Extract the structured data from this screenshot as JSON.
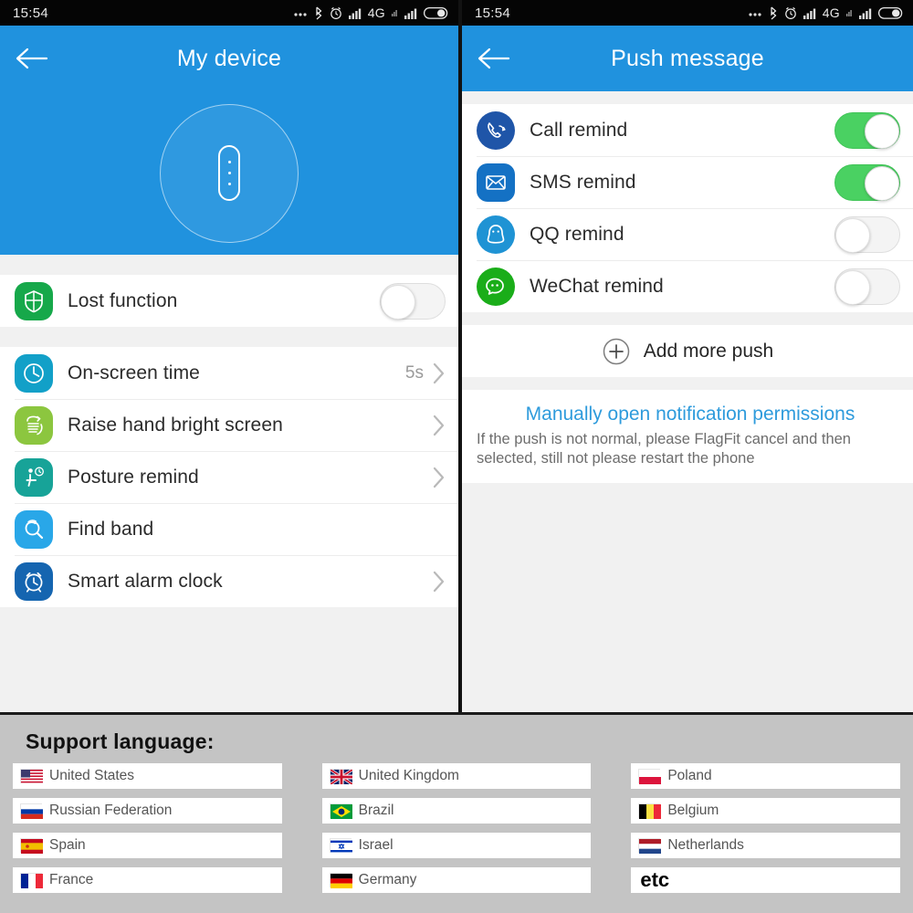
{
  "status_bar": {
    "time": "15:54",
    "icons": [
      "more-dots-icon",
      "bluetooth-icon",
      "alarm-icon",
      "signal-bars-icon",
      "network-4g-label",
      "signal-bars-2-icon",
      "battery-icon"
    ],
    "network_label": "4G"
  },
  "left_panel": {
    "title": "My device",
    "back_label": "back-arrow",
    "device_illustration": "smart-band-in-circle",
    "group_one": [
      {
        "label": "Lost function",
        "icon": "shield-lost-icon",
        "icon_color": "#16a84a",
        "toggle": "off"
      }
    ],
    "group_two": [
      {
        "label": "On-screen time",
        "icon": "clock-icon",
        "icon_color": "#12a0c8",
        "value": "5s",
        "chevron": true
      },
      {
        "label": "Raise hand bright screen",
        "icon": "raise-hand-icon",
        "icon_color": "#8cc63f",
        "value": "",
        "chevron": true
      },
      {
        "label": "Posture remind",
        "icon": "posture-icon",
        "icon_color": "#17a398",
        "value": "",
        "chevron": true
      },
      {
        "label": "Find band",
        "icon": "find-band-icon",
        "icon_color": "#29a7e8",
        "value": "",
        "chevron": false
      },
      {
        "label": "Smart alarm clock",
        "icon": "alarm-clock-icon",
        "icon_color": "#1565b0",
        "value": "",
        "chevron": true
      }
    ]
  },
  "right_panel": {
    "title": "Push message",
    "back_label": "back-arrow",
    "reminders": [
      {
        "label": "Call remind",
        "icon": "phone-icon",
        "icon_color": "#1f55a8",
        "toggle": "on"
      },
      {
        "label": "SMS remind",
        "icon": "envelope-icon",
        "icon_color": "#1471c4",
        "toggle": "on"
      },
      {
        "label": "QQ remind",
        "icon": "qq-penguin-icon",
        "icon_color": "#1f93d4",
        "toggle": "off"
      },
      {
        "label": "WeChat remind",
        "icon": "wechat-icon",
        "icon_color": "#1aad19",
        "toggle": "off"
      }
    ],
    "add_more_push": "Add more push",
    "permission_link": "Manually open notification permissions",
    "permission_desc": "If the push is not normal, please FlagFit cancel and then selected, still not please restart the phone"
  },
  "languages": {
    "title": "Support language:",
    "columns": [
      [
        {
          "name": "United States",
          "flag": "us"
        },
        {
          "name": "Russian Federation",
          "flag": "ru"
        },
        {
          "name": "Spain",
          "flag": "es"
        },
        {
          "name": "France",
          "flag": "fr"
        }
      ],
      [
        {
          "name": "United Kingdom",
          "flag": "gb"
        },
        {
          "name": "Brazil",
          "flag": "br"
        },
        {
          "name": "Israel",
          "flag": "il"
        },
        {
          "name": "Germany",
          "flag": "de"
        }
      ],
      [
        {
          "name": "Poland",
          "flag": "pl"
        },
        {
          "name": "Belgium",
          "flag": "be"
        },
        {
          "name": "Netherlands",
          "flag": "nl"
        },
        {
          "name": "etc",
          "flag": "none"
        }
      ]
    ]
  },
  "colors": {
    "accent_blue": "#2092de",
    "toggle_on_green": "#4ad162",
    "link_blue": "#2e9bdc",
    "page_background": "#c4c4c4"
  }
}
